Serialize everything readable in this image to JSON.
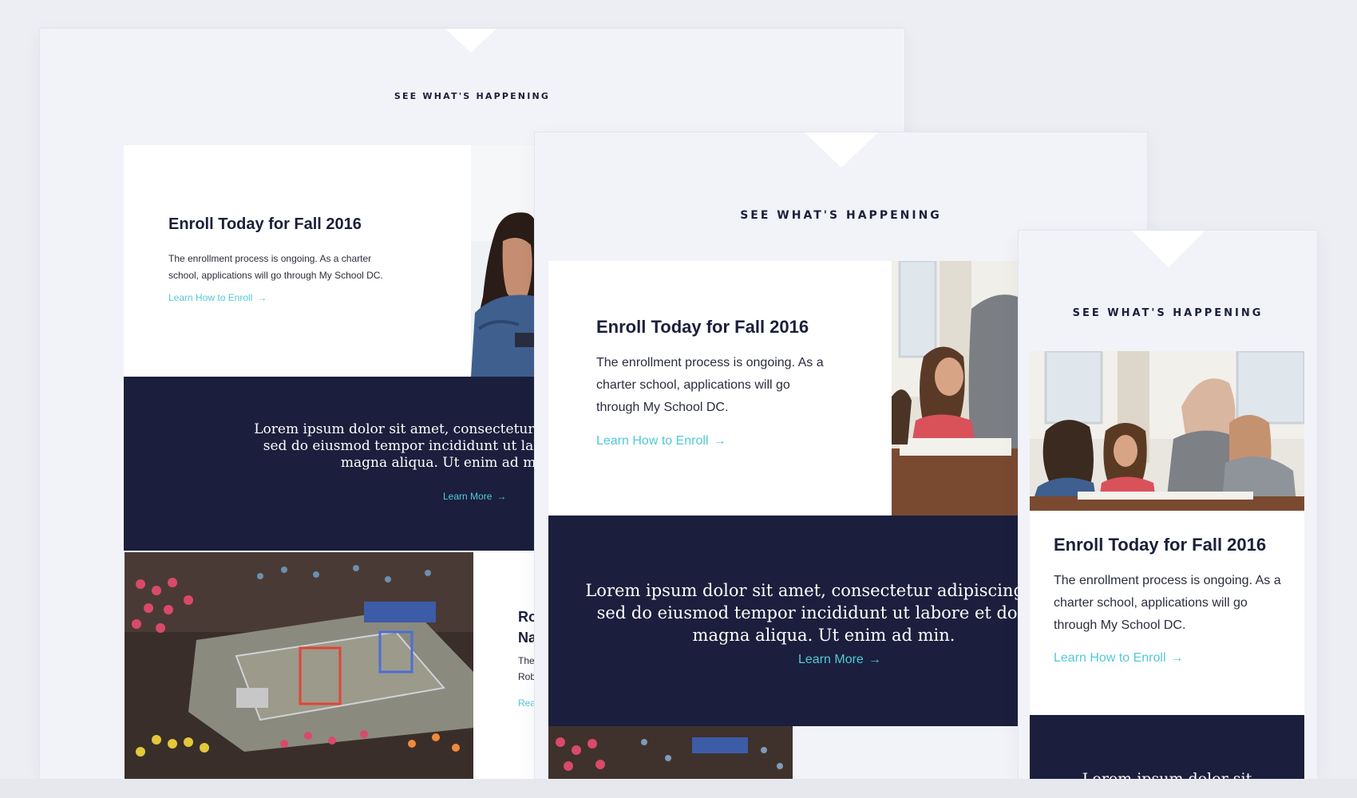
{
  "section_kicker": "SEE WHAT'S HAPPENING",
  "enroll_card": {
    "title": "Enroll Today for Fall 2016",
    "body": "The enrollment process is ongoing. As a charter school, applications will go through My School DC.",
    "link_label": "Learn How to Enroll",
    "arrow": "→"
  },
  "quote_band": {
    "text_large": "Lorem ipsum dolor sit amet, consectetur adipiscing elit, sed do eiusmod tempor incididunt ut labore et dolore magna aliqua. Ut enim ad min.",
    "text_small": "Lorem ipsum dolor sit amet, consectetur adipiscing elit, sed do eiusmod tempor incididunt ut labore et dolore magna aliqua. Ut enim ad min.",
    "link_label": "Learn More",
    "arrow": "→"
  },
  "desktop_robotics_card": {
    "title_partial": "Ro\nNa",
    "body_partial": "The\nRob",
    "link_partial": "Rea"
  },
  "mobile_quote_partial": "Lorem ipsum dolor sit",
  "colors": {
    "navy": "#1b1f3d",
    "accent": "#52c9d6",
    "frame_bg": "#f2f3f8",
    "page_bg": "#eceef3"
  },
  "icons": [
    "arrow-right-icon",
    "classroom-photo",
    "robotics-arena-photo"
  ]
}
